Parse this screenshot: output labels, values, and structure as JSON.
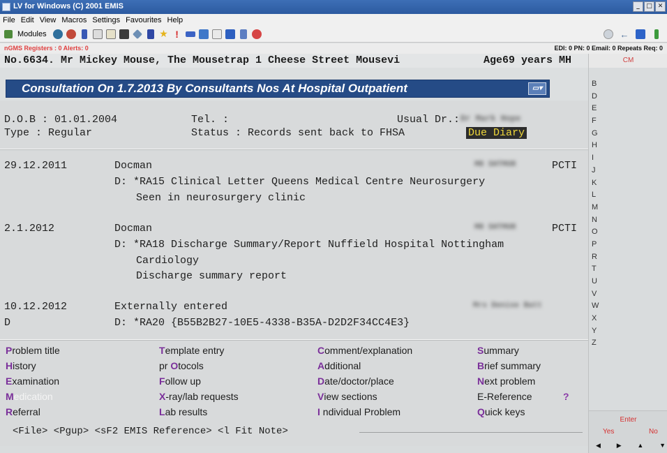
{
  "window": {
    "title": "LV for Windows (C) 2001 EMIS",
    "buttons": [
      "_",
      "□",
      "✕"
    ]
  },
  "menu": [
    "File",
    "Edit",
    "View",
    "Macros",
    "Settings",
    "Favourites",
    "Help"
  ],
  "toolbar": {
    "modules_label": "Modules",
    "icons": [
      "modules-icon",
      "users-icon",
      "globe-icon",
      "book-icon",
      "copy-icon",
      "paste-icon",
      "save-icon",
      "tools-icon",
      "flask-icon",
      "star-icon",
      "alert-icon",
      "message-icon",
      "monitor-icon",
      "calendar-icon",
      "chart-icon",
      "bell-icon",
      "pie-icon"
    ],
    "right_icons": [
      "stop-icon",
      "back-icon",
      "blue-square-icon",
      "green-icon"
    ]
  },
  "statusline": {
    "left": "nGMS Registers : 0  Alerts: 0",
    "right": "EDI: 0  PN: 0  Email: 0  Repeats Req: 0"
  },
  "patient": {
    "line": "No.6634. Mr Mickey Mouse, The Mousetrap 1 Cheese Street Mousevi",
    "age": "Age69 years MH"
  },
  "consultation": {
    "title": "Consultation On 1.7.2013 By Consultants Nos At Hospital Outpatient"
  },
  "details": {
    "dob": "D.O.B : 01.01.2004",
    "tel": "Tel.  :",
    "usual_dr_label": "Usual Dr.:",
    "usual_dr_value": "Dr Mark Hope",
    "type": "Type  : Regular",
    "status": "Status : Records sent back to FHSA",
    "due_diary": "Due Diary"
  },
  "entries": [
    {
      "date": "29.12.2011",
      "author": "Docman",
      "clinician": "MR SHTMOR",
      "tag": "PCTI",
      "lines": [
        "D: *RA15 Clinical Letter Queens Medical Centre Neurosurgery",
        "Seen in neurosurgery clinic"
      ]
    },
    {
      "date": "2.1.2012",
      "author": "Docman",
      "clinician": "MR SHTMOR",
      "tag": "PCTI",
      "lines": [
        "D: *RA18 Discharge Summary/Report Nuffield Hospital Nottingham",
        "Cardiology",
        "Discharge summary report"
      ]
    },
    {
      "date": "10.12.2012",
      "marker": "D",
      "author": "Externally entered",
      "clinician": "Mrs Denise Batt",
      "lines": [
        "D: *RA20 {B55B2B27-10E5-4338-B35A-D2D2F34CC4E3}"
      ]
    }
  ],
  "options": {
    "col1": [
      {
        "key": "P",
        "rest": "roblem title"
      },
      {
        "key": "H",
        "rest": "istory"
      },
      {
        "key": "E",
        "rest": "xamination"
      },
      {
        "key": "M",
        "rest": "edication",
        "selected": true
      },
      {
        "key": "R",
        "rest": "eferral"
      }
    ],
    "col2": [
      {
        "key": "T",
        "rest": "emplate entry"
      },
      {
        "pre": "pr ",
        "key": "O",
        "rest": "tocols"
      },
      {
        "key": "F",
        "rest": "ollow up"
      },
      {
        "key": "X",
        "rest": "-ray/lab requests"
      },
      {
        "key": "L",
        "rest": "ab results"
      }
    ],
    "col3": [
      {
        "key": "C",
        "rest": "omment/explanation"
      },
      {
        "key": "A",
        "rest": "dditional"
      },
      {
        "key": "D",
        "rest": "ate/doctor/place"
      },
      {
        "key": "V",
        "rest": "iew sections"
      },
      {
        "key": "I",
        "rest": " ndividual Problem"
      }
    ],
    "col4": [
      {
        "key": "S",
        "rest": "ummary"
      },
      {
        "key": "B",
        "rest": "rief summary"
      },
      {
        "key": "N",
        "rest": "ext problem"
      },
      {
        "pre": "E-Reference",
        "key": "",
        "rest": ""
      },
      {
        "key": "Q",
        "rest": "uick keys"
      }
    ],
    "help_mark": "?"
  },
  "function_keys": "<File> <Pgup> <sF2 EMIS Reference> <l Fit Note>",
  "right_panel": {
    "header": "CM",
    "letters": [
      "B",
      "D",
      "E",
      "F",
      "G",
      "H",
      "I",
      "J",
      "K",
      "L",
      "M",
      "N",
      "O",
      "P",
      "R",
      "T",
      "U",
      "V",
      "W",
      "X",
      "Y",
      "Z"
    ]
  },
  "enter_panel": {
    "enter": "Enter",
    "yes": "Yes",
    "no": "No",
    "arrows": [
      "◀",
      "▶",
      "▲",
      "▼"
    ]
  },
  "colors": {
    "title_blue": "#254b86",
    "hotkey_purple": "#7a2f9a",
    "alert_red": "#e04040",
    "due_diary_yellow": "#f0d83a"
  }
}
